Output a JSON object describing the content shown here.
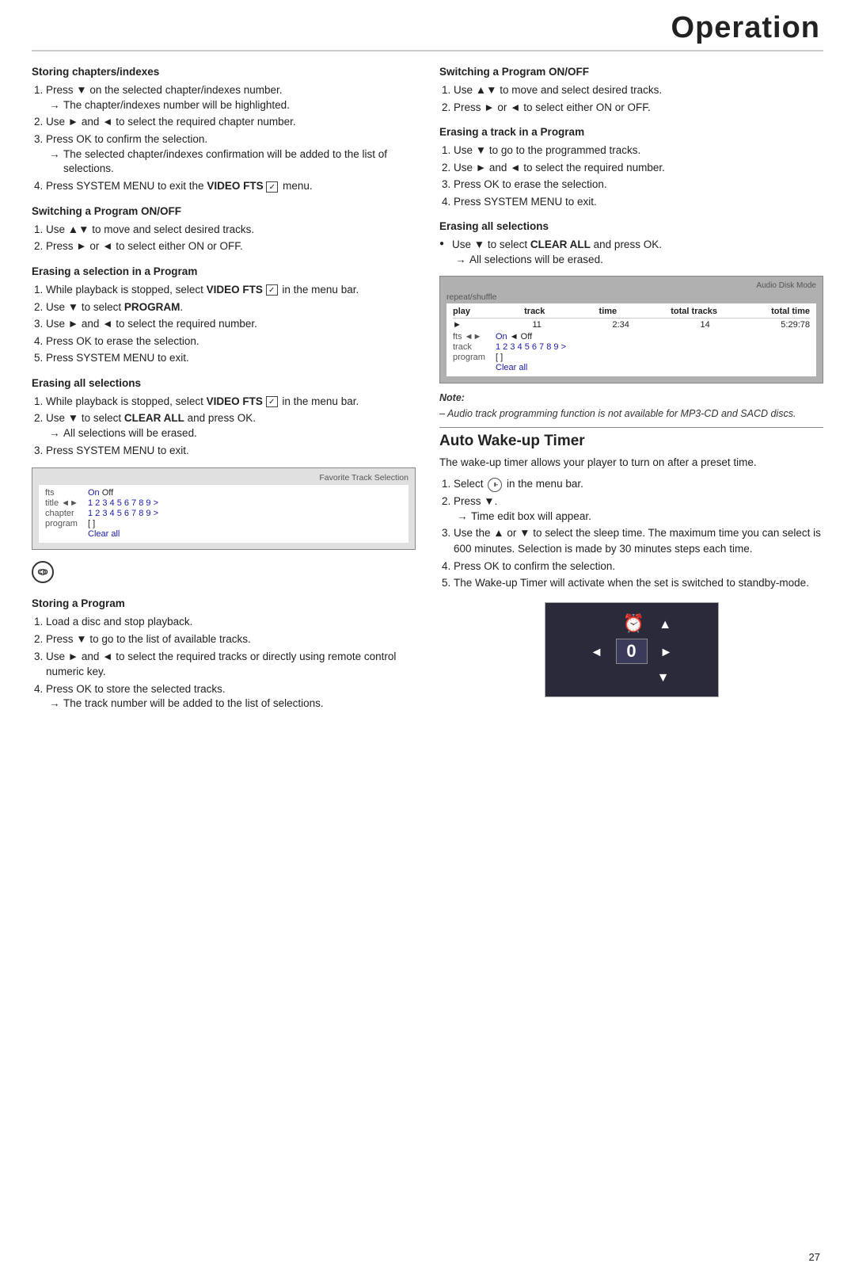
{
  "header": {
    "title": "Operation"
  },
  "left_col": {
    "sections": [
      {
        "id": "storing-chapters",
        "title": "Storing chapters/indexes",
        "steps": [
          {
            "num": 1,
            "text": "Press ▼ on the selected chapter/indexes number.",
            "sub": "The chapter/indexes number will be highlighted."
          },
          {
            "num": 2,
            "text": "Use ► and ◄ to select the required chapter number.",
            "sub": null
          },
          {
            "num": 3,
            "text": "Press OK to confirm the selection.",
            "sub": "The selected chapter/indexes confirmation will be added to the list of selections."
          },
          {
            "num": 4,
            "text": "Press SYSTEM MENU to exit the VIDEO FTS  menu.",
            "sub": null,
            "bold_part": "VIDEO FTS"
          }
        ]
      },
      {
        "id": "switching-program-left",
        "title": "Switching a Program ON/OFF",
        "steps": [
          {
            "num": 1,
            "text": "Use ▲▼ to move and select desired tracks.",
            "sub": null
          },
          {
            "num": 2,
            "text": "Press ► or ◄ to select either ON or OFF.",
            "sub": null
          }
        ]
      },
      {
        "id": "erasing-selection",
        "title": "Erasing a selection in a Program",
        "steps": [
          {
            "num": 1,
            "text": "While playback is stopped, select VIDEO FTS  in the menu bar.",
            "sub": null,
            "bold_part": "VIDEO FTS"
          },
          {
            "num": 2,
            "text": "Use ▼ to select PROGRAM.",
            "sub": null,
            "bold_part": "PROGRAM"
          },
          {
            "num": 3,
            "text": "Use ► and ◄ to select the required number.",
            "sub": null
          },
          {
            "num": 4,
            "text": "Press OK to erase the selection.",
            "sub": null
          },
          {
            "num": 5,
            "text": "Press SYSTEM MENU to exit.",
            "sub": null
          }
        ]
      },
      {
        "id": "erasing-all-left",
        "title": "Erasing all selections",
        "steps": [
          {
            "num": 1,
            "text": "While playback is stopped, select VIDEO FTS  in the menu bar.",
            "sub": null,
            "bold_part": "VIDEO FTS"
          },
          {
            "num": 2,
            "text": "Use ▼ to select CLEAR ALL and press OK.",
            "sub": "All selections will be erased.",
            "bold_part": "CLEAR ALL"
          },
          {
            "num": 3,
            "text": "Press SYSTEM MENU to exit.",
            "sub": null
          }
        ]
      }
    ],
    "fts_screenshot": {
      "label": "Favorite Track Selection",
      "rows": [
        {
          "label": "fts",
          "val": "On  Off"
        },
        {
          "label": "title ◄►",
          "val": "1  2  3  4  5  6  7  8  9  >"
        },
        {
          "label": "chapter",
          "val": "1  2  3  4  5  6  7  8  9  >"
        },
        {
          "label": "program",
          "val": "[ ]"
        },
        {
          "label": "",
          "val": "Clear all"
        }
      ]
    },
    "cd_section": {
      "title": "Storing a Program",
      "steps": [
        {
          "num": 1,
          "text": "Load a disc and stop playback.",
          "sub": null
        },
        {
          "num": 2,
          "text": "Press ▼ to go to the list of available tracks.",
          "sub": null
        },
        {
          "num": 3,
          "text": "Use ► and ◄ to select the required tracks or directly using remote control numeric key.",
          "sub": null
        },
        {
          "num": 4,
          "text": "Press OK to store the selected tracks.",
          "sub": "The track number will be added to the list of selections."
        }
      ]
    }
  },
  "right_col": {
    "sections": [
      {
        "id": "switching-program-right",
        "title": "Switching a Program ON/OFF",
        "steps": [
          {
            "num": 1,
            "text": "Use ▲▼ to move and select desired tracks.",
            "sub": null
          },
          {
            "num": 2,
            "text": "Press ► or ◄ to select either ON or OFF.",
            "sub": null
          }
        ]
      },
      {
        "id": "erasing-track",
        "title": "Erasing a track in a Program",
        "steps": [
          {
            "num": 1,
            "text": "Use ▼ to go to the programmed tracks.",
            "sub": null
          },
          {
            "num": 2,
            "text": "Use ► and ◄ to select the required number.",
            "sub": null
          },
          {
            "num": 3,
            "text": "Press OK to erase the selection.",
            "sub": null
          },
          {
            "num": 4,
            "text": "Press SYSTEM MENU to exit.",
            "sub": null
          }
        ]
      },
      {
        "id": "erasing-all-right",
        "title": "Erasing all selections",
        "bullet": "Use ▼ to select CLEAR ALL and press OK.",
        "bullet_bold": "CLEAR ALL",
        "bullet_sub": "All selections will be erased."
      }
    ],
    "audio_screenshot": {
      "header_left": "repeat/shuffle",
      "header_right": "Audio Disk Mode",
      "rows_head": [
        "play",
        "track",
        "time",
        "total tracks",
        "total time"
      ],
      "row1": [
        "►",
        "11",
        "2:34",
        "14",
        "5:29:78"
      ],
      "fts_row": "fts ◄► On  ◄ Off",
      "track_row": "track | 1  2  3  4  5  6  7  8  9  >",
      "program_row": "program | [ ]",
      "clear_row": "Clear all"
    },
    "note": {
      "label": "Note:",
      "text": "– Audio track programming function is not available for MP3-CD and SACD discs."
    },
    "auto_timer": {
      "title": "Auto Wake-up Timer",
      "intro": "The wake-up timer allows your player to turn on after a preset time.",
      "steps": [
        {
          "num": 1,
          "text": "Select  in the menu bar.",
          "has_icon": true
        },
        {
          "num": 2,
          "text": "Press ▼.",
          "sub": "Time edit box will appear."
        },
        {
          "num": 3,
          "text": "Use the ▲ or ▼ to select the sleep time. The maximum time you can select is 600 minutes. Selection is made by 30 minutes steps each time.",
          "sub": null
        },
        {
          "num": 4,
          "text": "Press OK to confirm the selection.",
          "sub": null
        },
        {
          "num": 5,
          "text": "The Wake-up Timer will activate when the set is switched to standby-mode.",
          "sub": null
        }
      ],
      "display": {
        "icon": "⏰",
        "value": "0"
      }
    }
  },
  "page_number": "27"
}
